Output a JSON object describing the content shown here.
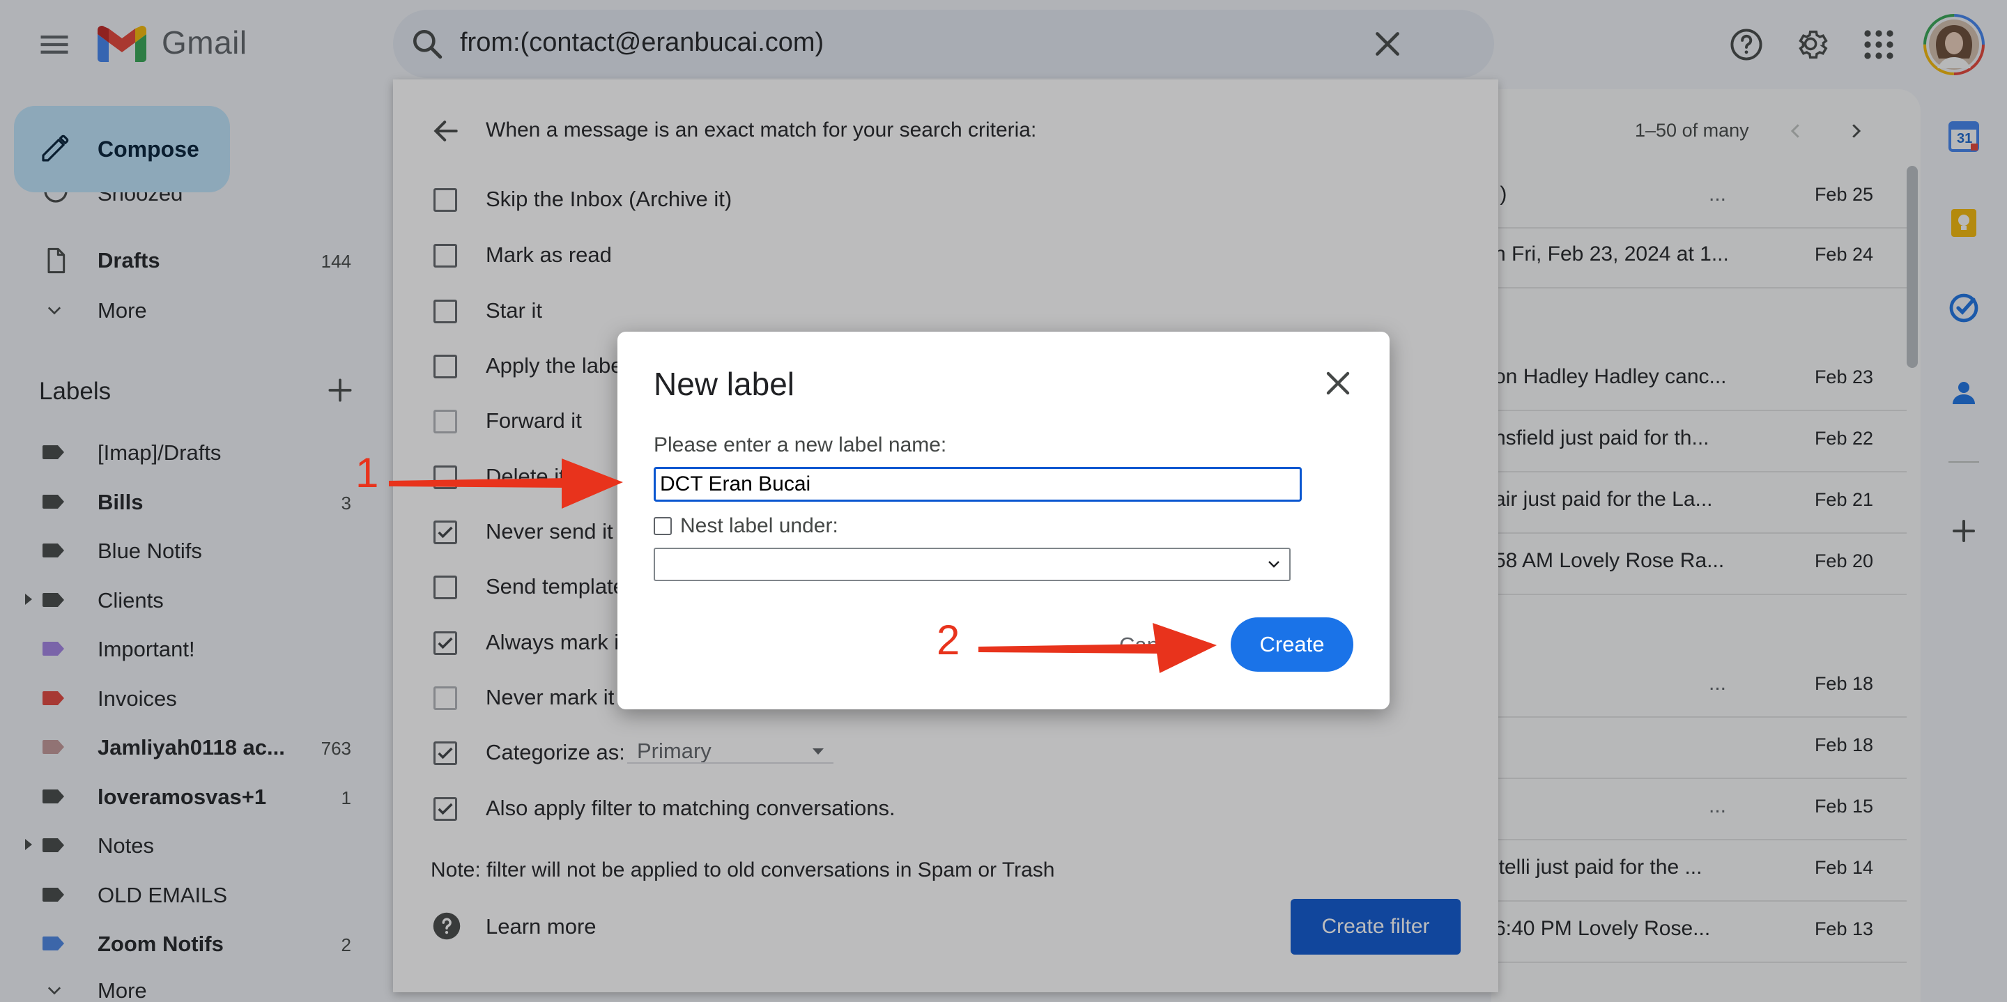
{
  "app": {
    "brand": "Gmail"
  },
  "search": {
    "query": "from:(contact@eranbucai.com)"
  },
  "compose": {
    "label": "Compose"
  },
  "nav": {
    "partial_item": "Snoozed",
    "drafts": {
      "label": "Drafts",
      "count": "144"
    },
    "more": "More",
    "more_bottom": "More"
  },
  "labels": {
    "heading": "Labels",
    "items": [
      {
        "name": "[Imap]/Drafts",
        "count": "",
        "bold": false,
        "color": "#444746"
      },
      {
        "name": "Bills",
        "count": "3",
        "bold": true,
        "color": "#444746"
      },
      {
        "name": "Blue Notifs",
        "count": "",
        "bold": false,
        "color": "#444746"
      },
      {
        "name": "Clients",
        "count": "",
        "bold": false,
        "color": "#444746"
      },
      {
        "name": "Important!",
        "count": "",
        "bold": false,
        "color": "#a583e8"
      },
      {
        "name": "Invoices",
        "count": "",
        "bold": false,
        "color": "#e8453c"
      },
      {
        "name": "Jamliyah0118 ac...",
        "count": "763",
        "bold": true,
        "color": "#c79a9a"
      },
      {
        "name": "loveramosvas+1",
        "count": "1",
        "bold": true,
        "color": "#444746"
      },
      {
        "name": "Notes",
        "count": "",
        "bold": false,
        "color": "#444746"
      },
      {
        "name": "OLD EMAILS",
        "count": "",
        "bold": false,
        "color": "#444746"
      },
      {
        "name": "Zoom Notifs",
        "count": "2",
        "bold": true,
        "color": "#4a86e8"
      }
    ]
  },
  "mail_list": {
    "range": "1–50 of many",
    "rows": [
      {
        "snippet": ".)",
        "dots": "...",
        "date": "Feb 25"
      },
      {
        "snippet": "n Fri, Feb 23, 2024 at 1...",
        "dots": "",
        "date": "Feb 24"
      },
      {
        "snippet": "on Hadley Hadley canc...",
        "dots": "",
        "date": "Feb 23"
      },
      {
        "snippet": "nsfield just paid for th...",
        "dots": "",
        "date": "Feb 22"
      },
      {
        "snippet": "air just paid for the La...",
        "dots": "",
        "date": "Feb 21"
      },
      {
        "snippet": "58 AM Lovely Rose Ra...",
        "dots": "",
        "date": "Feb 20"
      },
      {
        "snippet": "",
        "dots": "...",
        "date": "Feb 18"
      },
      {
        "snippet": "",
        "dots": "",
        "date": "Feb 18"
      },
      {
        "snippet": "",
        "dots": "...",
        "date": "Feb 15"
      },
      {
        "snippet": "itelli just paid for the ...",
        "dots": "",
        "date": "Feb 14"
      },
      {
        "snippet": "6:40 PM Lovely Rose...",
        "dots": "",
        "date": "Feb 13"
      }
    ]
  },
  "filter": {
    "criteria": "When a message is an exact match for your search criteria:",
    "options": [
      {
        "label": "Skip the Inbox (Archive it)",
        "checked": false
      },
      {
        "label": "Mark as read",
        "checked": false
      },
      {
        "label": "Star it",
        "checked": false
      },
      {
        "label": "Apply the label",
        "checked": false
      },
      {
        "label": "Forward it",
        "checked": false
      },
      {
        "label": "Delete it",
        "checked": false
      },
      {
        "label": "Never send it",
        "checked": true
      },
      {
        "label": "Send template",
        "checked": false
      },
      {
        "label": "Always mark i",
        "checked": true
      },
      {
        "label": "Never mark it",
        "checked": false
      },
      {
        "label": "Categorize as:",
        "checked": true
      },
      {
        "label": "Also apply filter to matching conversations.",
        "checked": true
      }
    ],
    "categorize_value": "Primary",
    "note": "Note: filter will not be applied to old conversations in Spam or Trash",
    "learn_more": "Learn more",
    "create_filter": "Create filter"
  },
  "dialog": {
    "title": "New label",
    "prompt": "Please enter a new label name:",
    "input_value": "DCT Eran Bucai",
    "nest_label": "Nest label under:",
    "cancel": "Can",
    "create": "Create"
  },
  "annotations": {
    "step1": "1",
    "step2": "2",
    "color": "#e8331c"
  },
  "rail": {
    "calendar_day": "31"
  }
}
